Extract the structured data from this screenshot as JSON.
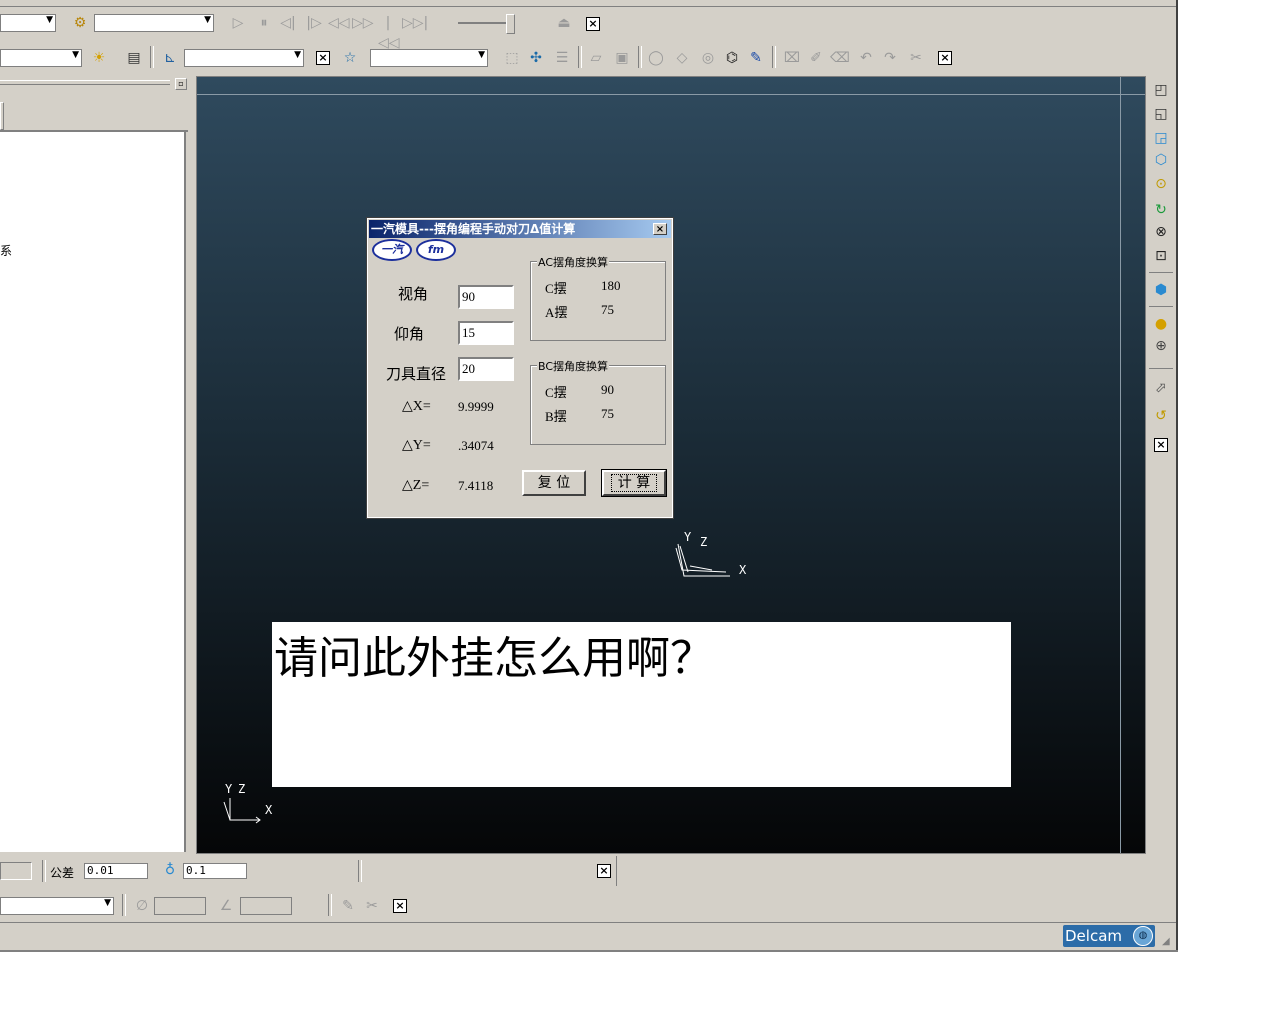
{
  "toolbar1": {
    "rewind_icon": "rewind-icon",
    "slider_label": ""
  },
  "tree": {
    "item_label": "系"
  },
  "dialog": {
    "title": "一汽模具---摆角编程手动对刀Δ值计算",
    "close_label": "×",
    "logo1": "一汽",
    "logo2": "fm",
    "view_angle_label": "视角",
    "view_angle_value": "90",
    "elevation_label": "仰角",
    "elevation_value": "15",
    "tool_diameter_label": "刀具直径",
    "tool_diameter_value": "20",
    "dx_label": "△X=",
    "dx_value": "9.9999",
    "dy_label": "△Y=",
    "dy_value": ".34074",
    "dz_label": "△Z=",
    "dz_value": "7.4118",
    "ac_group_title": "AC摆角度换算",
    "ac_c_label": "C摆",
    "ac_c_value": "180",
    "ac_a_label": "A摆",
    "ac_a_value": "75",
    "bc_group_title": "BC摆角度换算",
    "bc_c_label": "C摆",
    "bc_c_value": "90",
    "bc_b_label": "B摆",
    "bc_b_value": "75",
    "reset_label": "复 位",
    "calc_label": "计 算"
  },
  "viewport": {
    "axis_center": {
      "y": "Y",
      "z": "Z",
      "x": "X"
    },
    "axis_corner": {
      "y": "Y",
      "z": "Z",
      "x": "X"
    },
    "question": "请问此外挂怎么用啊？"
  },
  "statusbar": {
    "tolerance_label": "公差",
    "tolerance_value": "0.01",
    "stepover_value": "0.1"
  },
  "brand": {
    "name": "Delcam"
  },
  "colors": {
    "window_bg": "#d4d0c8",
    "title_gradient_start": "#0a246a",
    "title_gradient_end": "#a6caf0",
    "viewport_top": "#2f4a5e",
    "viewport_bottom": "#050607",
    "brand_blue": "#2c6ca8"
  }
}
